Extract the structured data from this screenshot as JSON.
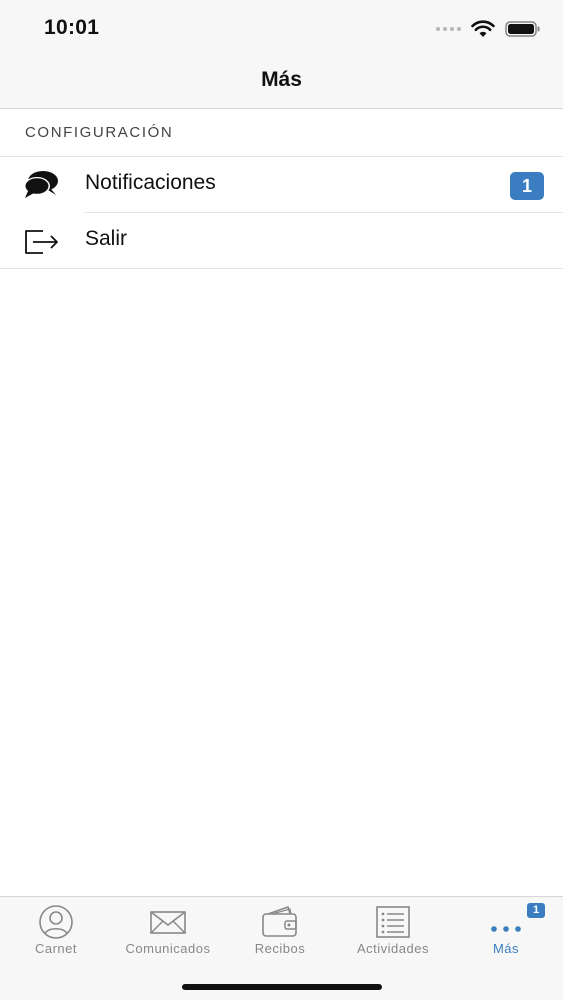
{
  "status_bar": {
    "time": "10:01",
    "icons": [
      "signal-dots-icon",
      "wifi-icon",
      "battery-icon"
    ]
  },
  "nav": {
    "title": "Más"
  },
  "section": {
    "header": "CONFIGURACIÓN",
    "items": [
      {
        "label": "Notificaciones",
        "icon": "chat-bubbles-icon",
        "badge": "1"
      },
      {
        "label": "Salir",
        "icon": "logout-icon"
      }
    ]
  },
  "tab_bar": {
    "tabs": [
      {
        "label": "Carnet",
        "icon": "user-circle-icon"
      },
      {
        "label": "Comunicados",
        "icon": "envelope-icon"
      },
      {
        "label": "Recibos",
        "icon": "wallet-icon"
      },
      {
        "label": "Actividades",
        "icon": "list-icon"
      },
      {
        "label": "Más",
        "icon": "more-dots-icon",
        "active": true,
        "badge": "1"
      }
    ]
  },
  "colors": {
    "accent": "#3a7dc0",
    "bar_background": "#f7f7f7",
    "inactive_tab": "#888888"
  }
}
